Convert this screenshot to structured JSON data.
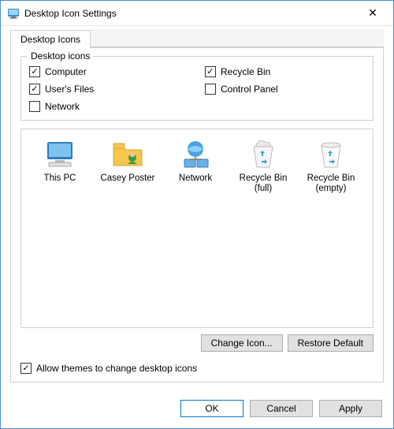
{
  "title": "Desktop Icon Settings",
  "tab": {
    "label": "Desktop Icons"
  },
  "group": {
    "label": "Desktop icons"
  },
  "checkboxes": {
    "computer": {
      "label": "Computer",
      "checked": true
    },
    "recycle_bin": {
      "label": "Recycle Bin",
      "checked": true
    },
    "users_files": {
      "label": "User's Files",
      "checked": true
    },
    "control_panel": {
      "label": "Control Panel",
      "checked": false
    },
    "network": {
      "label": "Network",
      "checked": false
    }
  },
  "icons": {
    "this_pc": {
      "label": "This PC",
      "selected": false
    },
    "user": {
      "label": "Casey Poster",
      "selected": false
    },
    "network": {
      "label": "Network",
      "selected": false
    },
    "rb_full": {
      "label": "Recycle Bin (full)",
      "selected": false
    },
    "rb_empty": {
      "label": "Recycle Bin (empty)",
      "selected": false
    }
  },
  "buttons": {
    "change_icon": "Change Icon...",
    "restore_default": "Restore Default",
    "ok": "OK",
    "cancel": "Cancel",
    "apply": "Apply"
  },
  "allow_themes": {
    "label": "Allow themes to change desktop icons",
    "checked": true
  }
}
